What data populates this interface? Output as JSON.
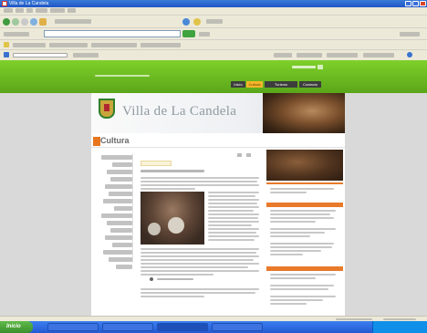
{
  "window": {
    "title": "Villa de La Candela"
  },
  "browser": {
    "menu": [
      "Archivo",
      "Edición",
      "Ver",
      "Favoritos",
      "Herramientas",
      "Ayuda"
    ],
    "address_value": "",
    "go_label": "Ir",
    "links_label": "Vínculos"
  },
  "site": {
    "nav_items": [
      {
        "label": "Inicio",
        "active": false
      },
      {
        "label": "Cultura",
        "active": true
      },
      {
        "label": "Turismo",
        "active": false
      },
      {
        "label": "Contacto",
        "active": false
      }
    ],
    "banner_title": "Villa de La Candela",
    "section_title": "Cultura",
    "left_nav": [
      "",
      "",
      "",
      "",
      "",
      "",
      "",
      "",
      "",
      "",
      "",
      "",
      "",
      "",
      "",
      "",
      "",
      ""
    ],
    "article": {
      "kicker": "",
      "title": "",
      "caption": ""
    }
  },
  "taskbar": {
    "start_label": "Inicio",
    "tasks": [
      "",
      "",
      "",
      ""
    ],
    "clock": ""
  },
  "colors": {
    "site_green": "#6ec023",
    "accent_orange": "#e87a2a",
    "taskbar_blue": "#2458d2"
  }
}
